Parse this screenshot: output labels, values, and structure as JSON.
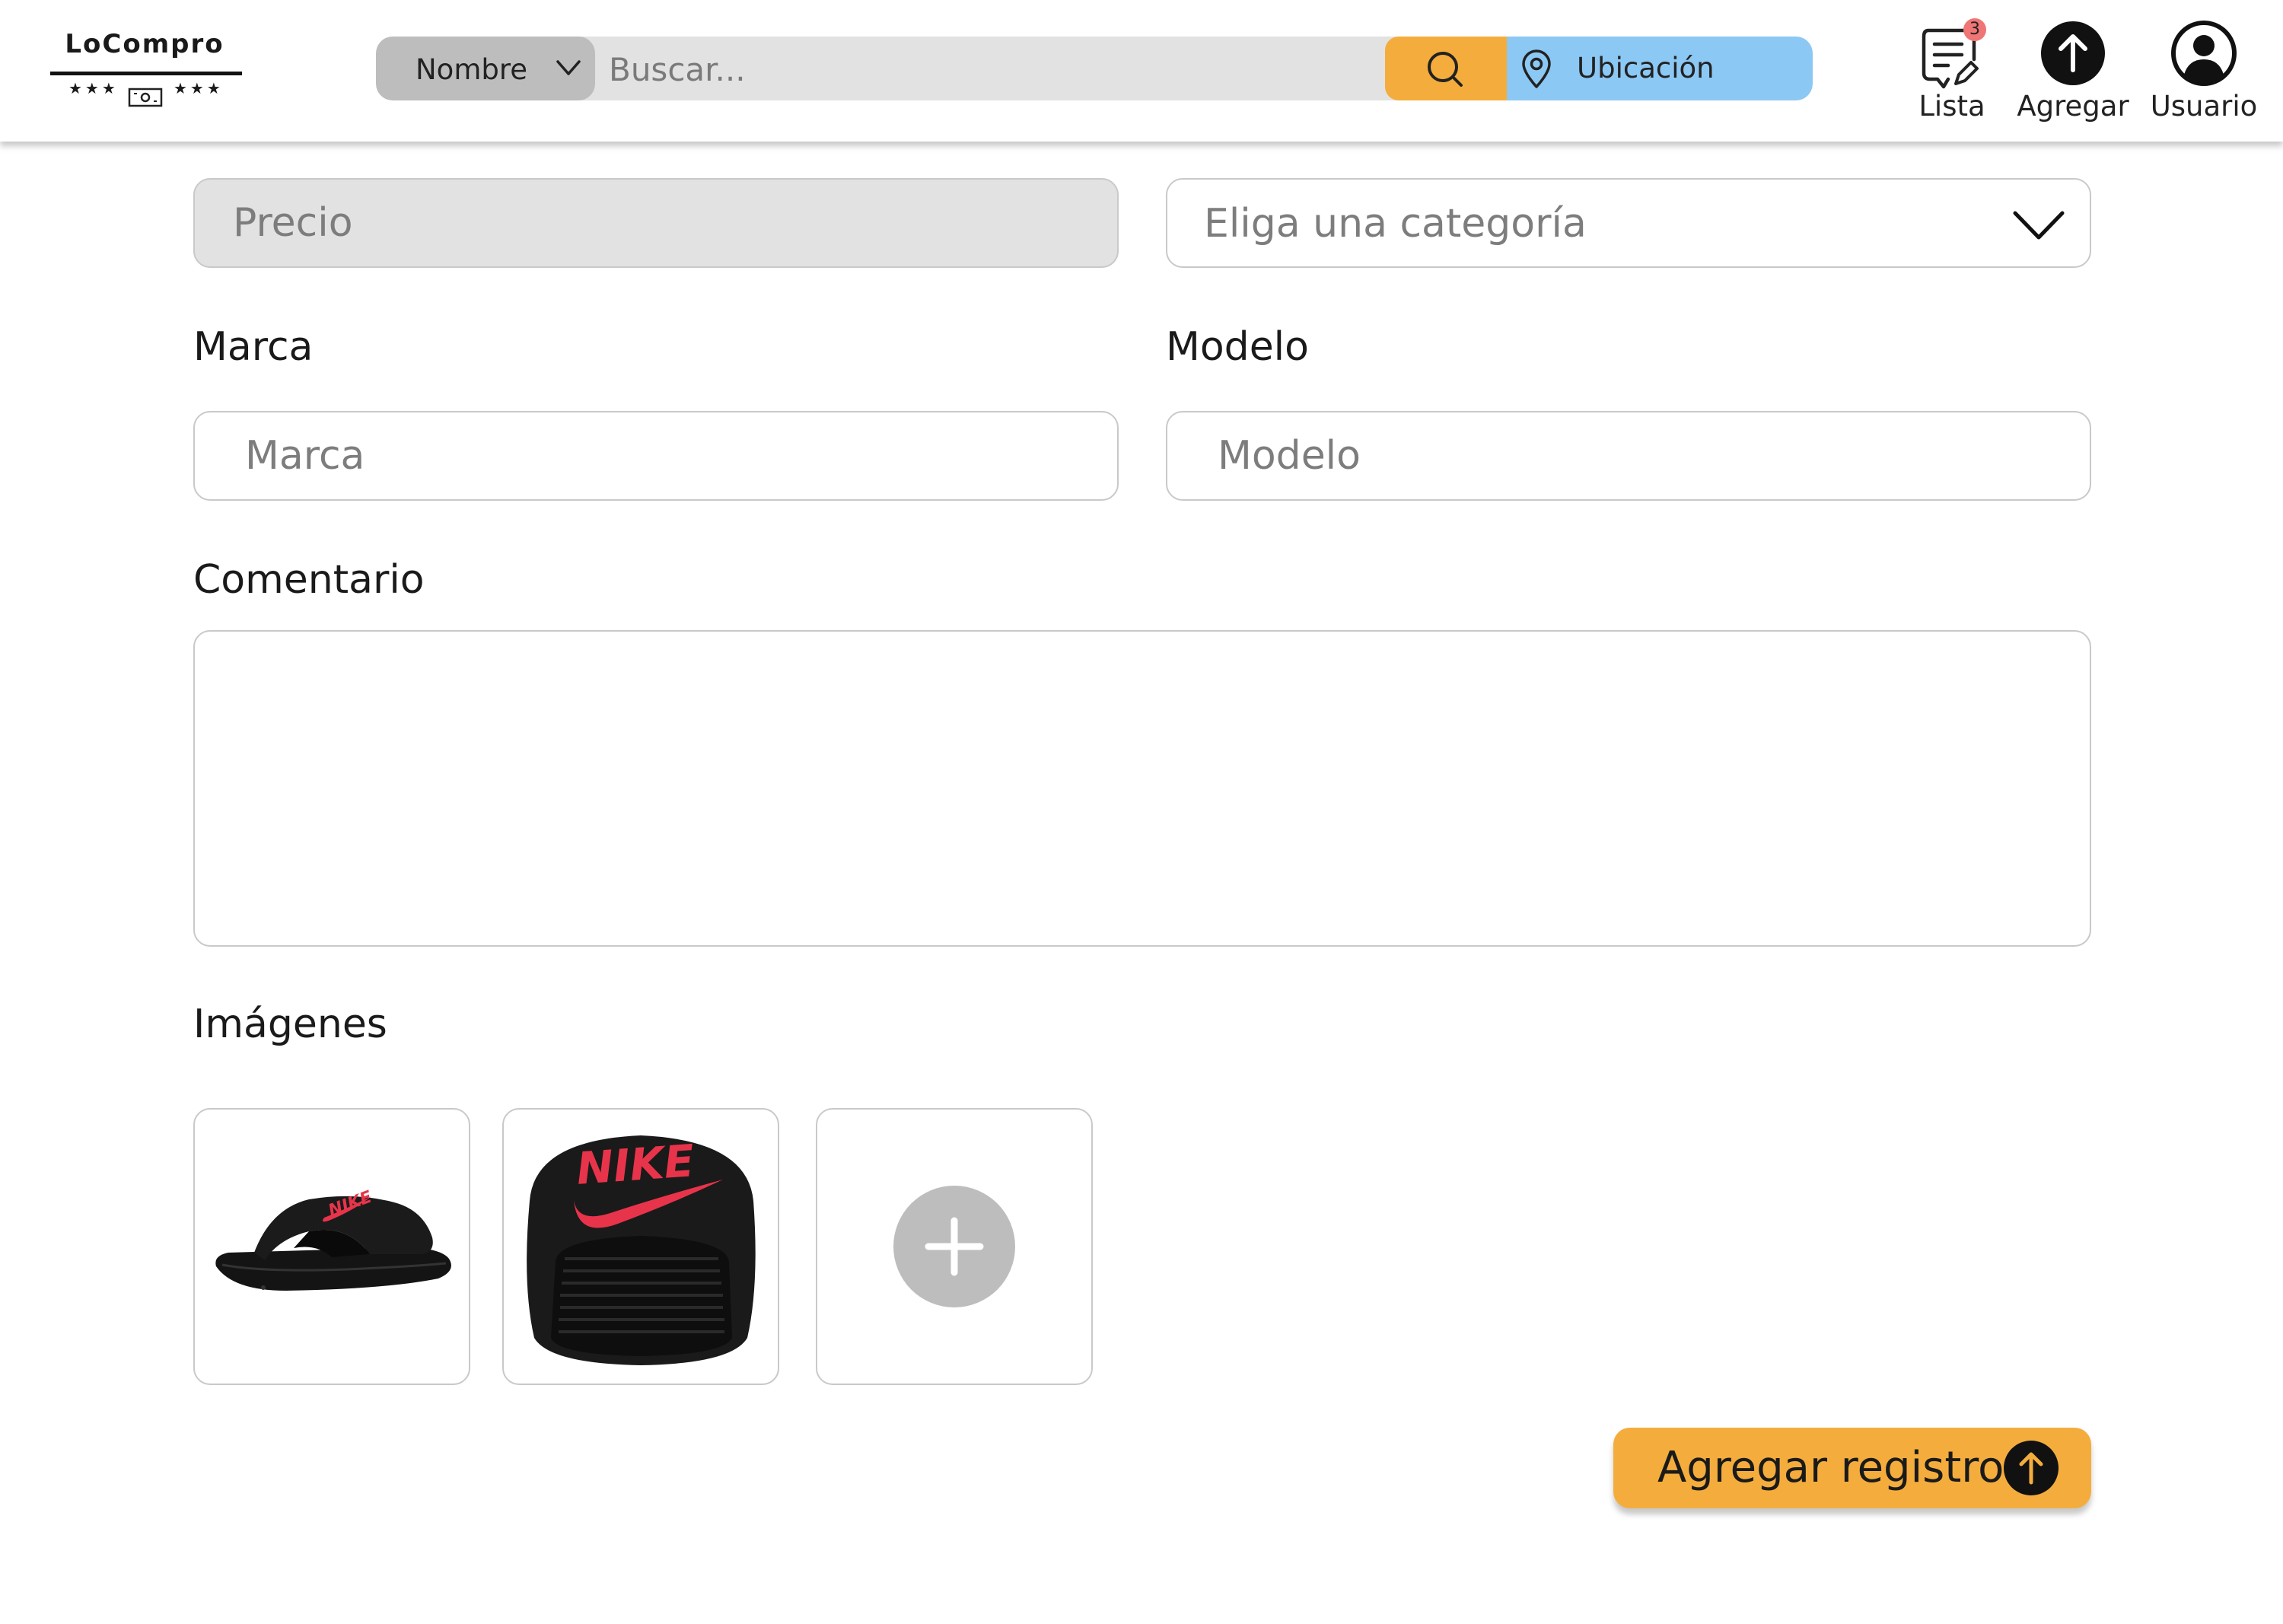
{
  "header": {
    "logo": {
      "name": "LoCompro",
      "stars_left": "★★★",
      "stars_right": "★★★"
    },
    "search": {
      "type_label": "Nombre",
      "placeholder": "Buscar...",
      "location_label": "Ubicación"
    },
    "nav": {
      "lista": {
        "label": "Lista",
        "badge": "3"
      },
      "agregar": {
        "label": "Agregar"
      },
      "usuario": {
        "label": "Usuario"
      }
    }
  },
  "form": {
    "precio_placeholder": "Precio",
    "categoria_placeholder": "Eliga una categoría",
    "marca_label": "Marca",
    "marca_placeholder": "Marca",
    "modelo_label": "Modelo",
    "modelo_placeholder": "Modelo",
    "comentario_label": "Comentario",
    "imagenes_label": "Imágenes",
    "submit_label": "Agregar registro",
    "images": [
      "nike-slide-side-image",
      "nike-slide-front-image"
    ]
  },
  "colors": {
    "accent_orange": "#f4ad3d",
    "location_blue": "#8cc8f4",
    "badge_red": "#f07575",
    "nike_red": "#e8344a"
  },
  "icons": [
    "chevron-down-icon",
    "search-icon",
    "location-pin-icon",
    "list-icon",
    "upload-icon",
    "user-icon",
    "plus-icon",
    "arrow-up-icon"
  ]
}
